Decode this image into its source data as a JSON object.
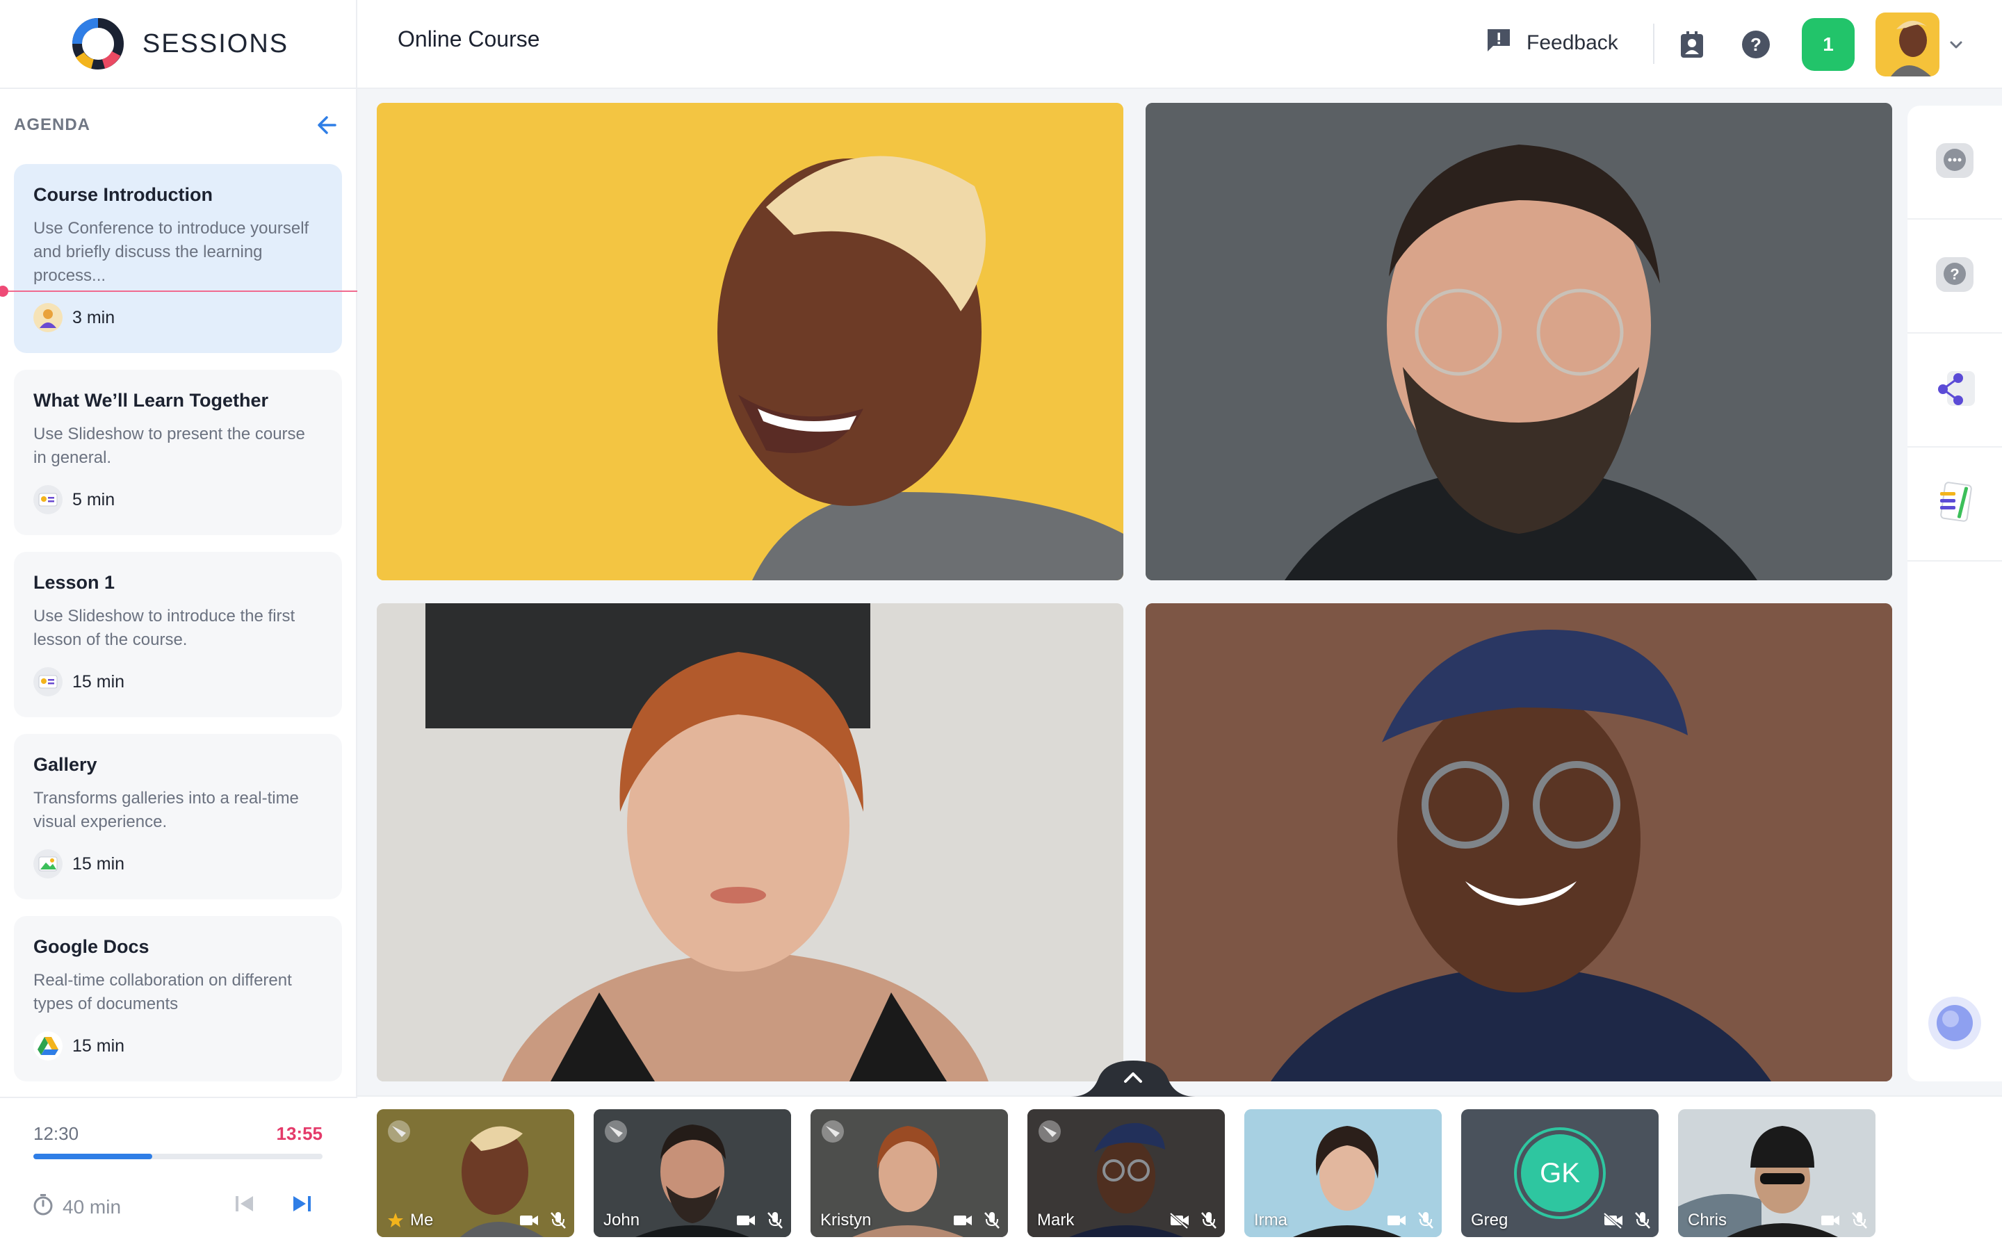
{
  "app": {
    "brand": "SESSIONS",
    "page_title": "Online Course"
  },
  "topbar": {
    "feedback_label": "Feedback",
    "notification_count": "1",
    "icons": [
      "feedback-icon",
      "contact-card-icon",
      "help-icon",
      "chevron-down-icon"
    ],
    "accent_green": "#22c46a"
  },
  "agenda": {
    "title": "AGENDA",
    "items": [
      {
        "title": "Course Introduction",
        "description": "Use Conference to introduce yourself and briefly discuss the learning process...",
        "duration": "3 min",
        "icon": "conference-icon",
        "active": true
      },
      {
        "title": "What We’ll Learn Together",
        "description": "Use Slideshow to present the course in general.",
        "duration": "5 min",
        "icon": "slideshow-icon",
        "active": false
      },
      {
        "title": "Lesson 1",
        "description": "Use Slideshow to introduce the first lesson of the course.",
        "duration": "15 min",
        "icon": "slideshow-icon",
        "active": false
      },
      {
        "title": "Gallery",
        "description": "Transforms galleries into a real-time visual experience.",
        "duration": "15 min",
        "icon": "gallery-icon",
        "active": false
      },
      {
        "title": "Google Docs",
        "description": "Real-time collaboration on different types of documents",
        "duration": "15 min",
        "icon": "google-drive-icon",
        "active": false
      }
    ]
  },
  "session": {
    "elapsed": "12:30",
    "end_time": "13:55",
    "progress_fraction": 0.41,
    "total": "40 min",
    "accent_red": "#e43a6a",
    "accent_blue": "#2f7ee6"
  },
  "participants": [
    {
      "name": "Me",
      "camera": "on",
      "mic": "muted",
      "pinned": true
    },
    {
      "name": "John",
      "camera": "on",
      "mic": "muted",
      "pinned": true
    },
    {
      "name": "Kristyn",
      "camera": "on",
      "mic": "muted",
      "pinned": true
    },
    {
      "name": "Mark",
      "camera": "off",
      "mic": "muted",
      "pinned": true
    },
    {
      "name": "Irma",
      "camera": "on",
      "mic": "muted",
      "pinned": false
    },
    {
      "name": "Greg",
      "camera": "off",
      "mic": "muted",
      "pinned": false,
      "initials": "GK"
    },
    {
      "name": "Chris",
      "camera": "on",
      "mic": "muted",
      "pinned": false
    }
  ],
  "rail": {
    "icons": [
      "chat-icon",
      "question-icon",
      "share-nodes-icon",
      "notes-icon",
      "assistant-orb-icon"
    ]
  }
}
